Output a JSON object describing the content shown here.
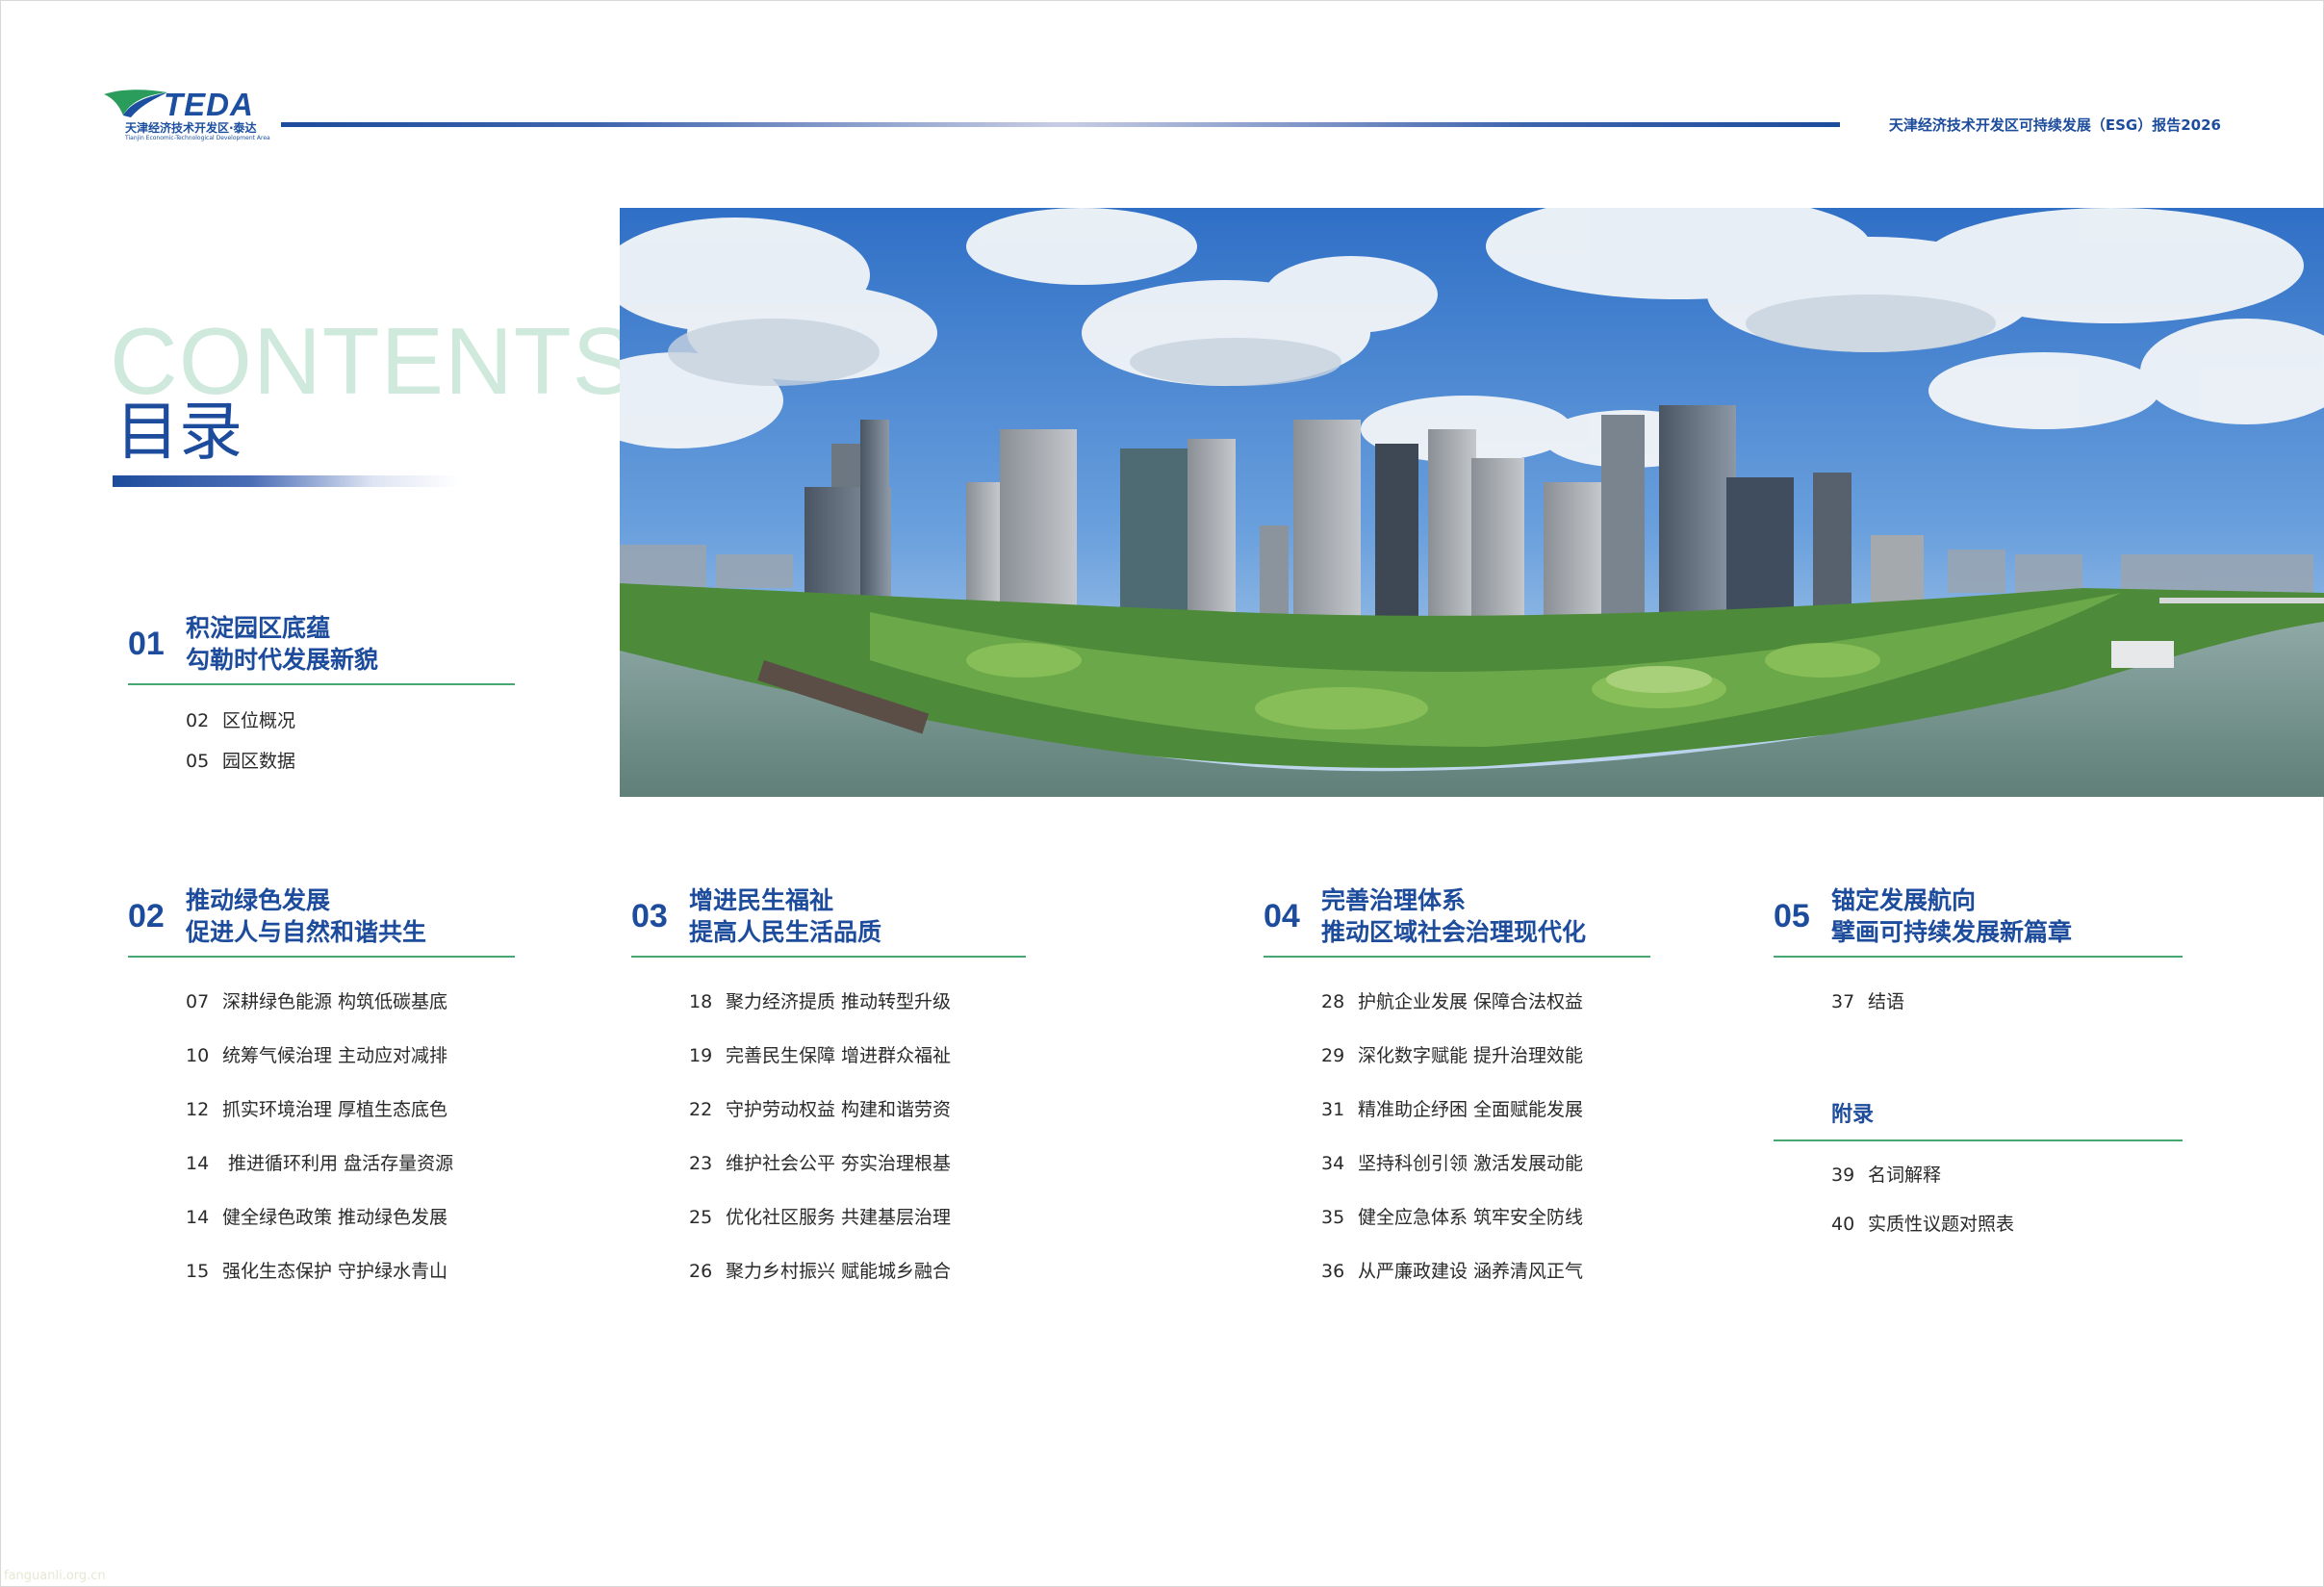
{
  "header": {
    "logo_word": "TEDA",
    "logo_cn": "天津经济技术开发区·泰达",
    "logo_en": "Tianjin Economic-Technological Development Area",
    "report_title": "天津经济技术开发区可持续发展（ESG）报告2026"
  },
  "heading": {
    "en": "CONTENTS",
    "cn": "目录"
  },
  "photo": {
    "description_icon": "city-skyline-photo"
  },
  "sections": [
    {
      "num": "01",
      "title_line1": "积淀园区底蕴",
      "title_line2": "勾勒时代发展新貌",
      "items": [
        {
          "page": "02",
          "text": "区位概况"
        },
        {
          "page": "05",
          "text": "园区数据"
        }
      ]
    },
    {
      "num": "02",
      "title_line1": "推动绿色发展",
      "title_line2": "促进人与自然和谐共生",
      "items": [
        {
          "page": "07",
          "text": "深耕绿色能源 构筑低碳基底"
        },
        {
          "page": "10",
          "text": "统筹气候治理 主动应对减排"
        },
        {
          "page": "12",
          "text": "抓实环境治理 厚植生态底色"
        },
        {
          "page": "14",
          "text": " 推进循环利用 盘活存量资源"
        },
        {
          "page": "14",
          "text": "健全绿色政策 推动绿色发展"
        },
        {
          "page": "15",
          "text": "强化生态保护 守护绿水青山"
        }
      ]
    },
    {
      "num": "03",
      "title_line1": "增进民生福祉",
      "title_line2": "提高人民生活品质",
      "items": [
        {
          "page": "18",
          "text": "聚力经济提质 推动转型升级"
        },
        {
          "page": "19",
          "text": "完善民生保障 增进群众福祉"
        },
        {
          "page": "22",
          "text": "守护劳动权益 构建和谐劳资"
        },
        {
          "page": "23",
          "text": "维护社会公平 夯实治理根基"
        },
        {
          "page": "25",
          "text": "优化社区服务 共建基层治理"
        },
        {
          "page": "26",
          "text": "聚力乡村振兴 赋能城乡融合"
        }
      ]
    },
    {
      "num": "04",
      "title_line1": "完善治理体系",
      "title_line2": "推动区域社会治理现代化",
      "items": [
        {
          "page": "28",
          "text": "护航企业发展 保障合法权益"
        },
        {
          "page": "29",
          "text": "深化数字赋能 提升治理效能"
        },
        {
          "page": "31",
          "text": "精准助企纾困 全面赋能发展"
        },
        {
          "page": "34",
          "text": "坚持科创引领 激活发展动能"
        },
        {
          "page": "35",
          "text": "健全应急体系 筑牢安全防线"
        },
        {
          "page": "36",
          "text": "从严廉政建设 涵养清风正气"
        }
      ]
    },
    {
      "num": "05",
      "title_line1": "锚定发展航向",
      "title_line2": "擘画可持续发展新篇章",
      "items": [
        {
          "page": "37",
          "text": "结语"
        }
      ]
    }
  ],
  "appendix": {
    "title": "附录",
    "items": [
      {
        "page": "39",
        "text": "名词解释"
      },
      {
        "page": "40",
        "text": "实质性议题对照表"
      }
    ]
  },
  "watermark": "fanguanli.org.cn"
}
